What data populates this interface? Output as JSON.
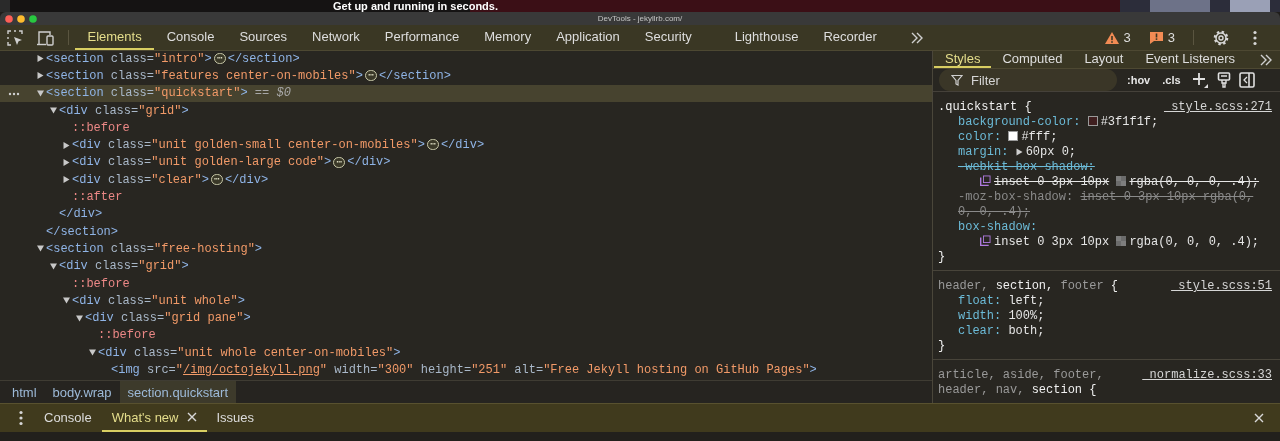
{
  "backdrop": {
    "heading": "Get up and running in seconds."
  },
  "window": {
    "title": "DevTools - jekyllrb.com/"
  },
  "toolbar": {
    "tabs": [
      {
        "label": "Elements",
        "selected": true
      },
      {
        "label": "Console",
        "selected": false
      },
      {
        "label": "Sources",
        "selected": false
      },
      {
        "label": "Network",
        "selected": false
      },
      {
        "label": "Performance",
        "selected": false
      },
      {
        "label": "Memory",
        "selected": false
      },
      {
        "label": "Application",
        "selected": false
      },
      {
        "label": "Security",
        "selected": false
      },
      {
        "label": "Lighthouse",
        "selected": false
      },
      {
        "label": "Recorder",
        "selected": false
      }
    ],
    "warnings": "3",
    "issues": "3"
  },
  "dom_tree": [
    {
      "kind": "element",
      "open": "<section",
      "attrs": [
        {
          "kind": "text",
          "name": "class=",
          "value": "\"intro\""
        }
      ],
      "end": ">",
      "expanded": false,
      "selected": false,
      "badge": "⋯",
      "close": "</section>"
    },
    {
      "kind": "element",
      "open": "<section",
      "attrs": [
        {
          "kind": "text",
          "name": "class=",
          "value": "\"features center-on-mobiles\""
        }
      ],
      "end": ">",
      "expanded": false,
      "selected": false,
      "badge": "⋯",
      "close": "</section>"
    },
    {
      "kind": "element",
      "open": "<section",
      "attrs": [
        {
          "kind": "text",
          "name": "class=",
          "value": "\"quickstart\""
        }
      ],
      "end": ">",
      "expanded": true,
      "selected": true,
      "marker": "== $0",
      "close": "</section>",
      "children": [
        {
          "kind": "element",
          "open": "<div",
          "attrs": [
            {
              "kind": "text",
              "name": "class=",
              "value": "\"grid\""
            }
          ],
          "end": ">",
          "expanded": true,
          "selected": false,
          "close": "</div>",
          "children": [
            {
              "kind": "pseudo",
              "text": "::before",
              "selected": false
            },
            {
              "kind": "element",
              "open": "<div",
              "attrs": [
                {
                  "kind": "text",
                  "name": "class=",
                  "value": "\"unit golden-small center-on-mobiles\""
                }
              ],
              "end": ">",
              "expanded": false,
              "selected": false,
              "badge": "⋯",
              "close": "</div>"
            },
            {
              "kind": "element",
              "open": "<div",
              "attrs": [
                {
                  "kind": "text",
                  "name": "class=",
                  "value": "\"unit golden-large code\""
                }
              ],
              "end": ">",
              "expanded": false,
              "selected": false,
              "badge": "⋯",
              "close": "</div>"
            },
            {
              "kind": "element",
              "open": "<div",
              "attrs": [
                {
                  "kind": "text",
                  "name": "class=",
                  "value": "\"clear\""
                }
              ],
              "end": ">",
              "expanded": false,
              "selected": false,
              "badge": "⋯",
              "close": "</div>"
            },
            {
              "kind": "pseudo",
              "text": "::after",
              "selected": false
            }
          ]
        }
      ]
    },
    {
      "kind": "element",
      "open": "<section",
      "attrs": [
        {
          "kind": "text",
          "name": "class=",
          "value": "\"free-hosting\""
        }
      ],
      "end": ">",
      "expanded": true,
      "selected": false,
      "children": [
        {
          "kind": "element",
          "open": "<div",
          "attrs": [
            {
              "kind": "text",
              "name": "class=",
              "value": "\"grid\""
            }
          ],
          "end": ">",
          "expanded": true,
          "selected": false,
          "children": [
            {
              "kind": "pseudo",
              "text": "::before",
              "selected": false
            },
            {
              "kind": "element",
              "open": "<div",
              "attrs": [
                {
                  "kind": "text",
                  "name": "class=",
                  "value": "\"unit whole\""
                }
              ],
              "end": ">",
              "expanded": true,
              "selected": false,
              "children": [
                {
                  "kind": "element",
                  "open": "<div",
                  "attrs": [
                    {
                      "kind": "text",
                      "name": "class=",
                      "value": "\"grid pane\""
                    }
                  ],
                  "end": ">",
                  "expanded": true,
                  "selected": false,
                  "children": [
                    {
                      "kind": "pseudo",
                      "text": "::before",
                      "selected": false
                    },
                    {
                      "kind": "element",
                      "open": "<div",
                      "attrs": [
                        {
                          "kind": "text",
                          "name": "class=",
                          "value": "\"unit whole center-on-mobiles\""
                        }
                      ],
                      "end": ">",
                      "expanded": true,
                      "selected": false,
                      "children": [
                        {
                          "kind": "leaf",
                          "open": "<img",
                          "attrs": [
                            {
                              "kind": "link",
                              "name": "src=",
                              "quote": "\"",
                              "value": "/img/octojekyll.png"
                            },
                            {
                              "kind": "text",
                              "name": "width=",
                              "value": "\"300\""
                            },
                            {
                              "kind": "text",
                              "name": "height=",
                              "value": "\"251\""
                            },
                            {
                              "kind": "text",
                              "name": "alt=",
                              "value": "\"Free Jekyll hosting on GitHub Pages\""
                            }
                          ],
                          "end": ">",
                          "selected": false
                        }
                      ]
                    }
                  ]
                }
              ]
            }
          ]
        }
      ]
    }
  ],
  "breadcrumbs": [
    {
      "label": "html",
      "selected": false
    },
    {
      "label": "body.wrap",
      "selected": false
    },
    {
      "label": "section.quickstart",
      "selected": true
    }
  ],
  "styles_pane": {
    "tabs": [
      {
        "label": "Styles",
        "selected": true
      },
      {
        "label": "Computed",
        "selected": false
      },
      {
        "label": "Layout",
        "selected": false
      },
      {
        "label": "Event Listeners",
        "selected": false
      }
    ],
    "filter": {
      "placeholder": "Filter"
    },
    "hov": ":hov",
    "cls": ".cls",
    "rules": [
      {
        "selectors": [
          {
            "text": ".quickstart",
            "matched": true
          }
        ],
        "brace": "{",
        "source": "_style.scss:271",
        "close": "}",
        "declarations": [
          {
            "kind": "color",
            "property": "background-color:",
            "value": "#3f1f1f;",
            "color": "#3f1f1f",
            "overridden": false,
            "invalid": false
          },
          {
            "kind": "color",
            "property": "color:",
            "value": "#fff;",
            "color": "#ffffff",
            "overridden": false,
            "invalid": false
          },
          {
            "kind": "shorthand",
            "property": "margin:",
            "value": "60px 0;",
            "overridden": false,
            "invalid": false
          },
          {
            "kind": "shadow",
            "property": "-webkit-box-shadow:",
            "value": "inset 0 3px 10px",
            "color_value": "rgba(0, 0, 0, .4);",
            "overridden": true,
            "invalid": false
          },
          {
            "kind": "plain",
            "property": "-moz-box-shadow:",
            "value": "inset 0 3px 10px rgba(0, 0, 0, .4);",
            "overridden": false,
            "invalid": true
          },
          {
            "kind": "shadow",
            "property": "box-shadow:",
            "value": "inset 0 3px 10px",
            "color_value": "rgba(0, 0, 0, .4);",
            "overridden": false,
            "invalid": false
          }
        ]
      },
      {
        "selectors": [
          {
            "text": "header,",
            "matched": false
          },
          {
            "text": "section,",
            "matched": true
          },
          {
            "text": "footer",
            "matched": false
          }
        ],
        "brace": "{",
        "source": "_style.scss:51",
        "close": "}",
        "declarations": [
          {
            "kind": "plain",
            "property": "float:",
            "value": "left;",
            "overridden": false,
            "invalid": false
          },
          {
            "kind": "plain",
            "property": "width:",
            "value": "100%;",
            "overridden": false,
            "invalid": false
          },
          {
            "kind": "plain",
            "property": "clear:",
            "value": "both;",
            "overridden": false,
            "invalid": false
          }
        ]
      },
      {
        "selectors": [
          {
            "text": "article,",
            "matched": false
          },
          {
            "text": "aside,",
            "matched": false
          },
          {
            "text": "footer,",
            "matched": false
          },
          {
            "text": "header,",
            "matched": false
          },
          {
            "text": "nav,",
            "matched": false
          },
          {
            "text": "section",
            "matched": true
          }
        ],
        "brace": "{",
        "source": "_normalize.scss:33"
      }
    ]
  },
  "drawer": {
    "tabs": [
      {
        "label": "Console",
        "selected": false,
        "closable": false
      },
      {
        "label": "What's new",
        "selected": true,
        "closable": true
      },
      {
        "label": "Issues",
        "selected": false,
        "closable": false
      }
    ]
  }
}
